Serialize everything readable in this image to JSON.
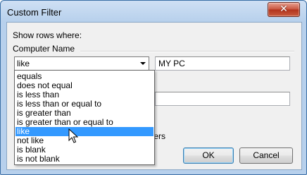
{
  "window": {
    "title": "Custom Filter"
  },
  "show_rows_label": "Show rows where:",
  "group_label": "Computer Name",
  "condition1": {
    "operator": "like",
    "value": "MY PC"
  },
  "condition2": {
    "value": ""
  },
  "hidden_text_fragment": "cters",
  "operator_options": [
    "equals",
    "does not equal",
    "is less than",
    "is less than or equal to",
    "is greater than",
    "is greater than or equal to",
    "like",
    "not like",
    "is blank",
    "is not blank"
  ],
  "selected_option": "like",
  "buttons": {
    "ok": "OK",
    "cancel": "Cancel"
  },
  "icons": {
    "close": "close-icon",
    "dropdown": "chevron-down-icon",
    "cursor": "mouse-pointer-icon"
  },
  "colors": {
    "selection": "#3399ff",
    "frame": "#b7d0ec"
  }
}
